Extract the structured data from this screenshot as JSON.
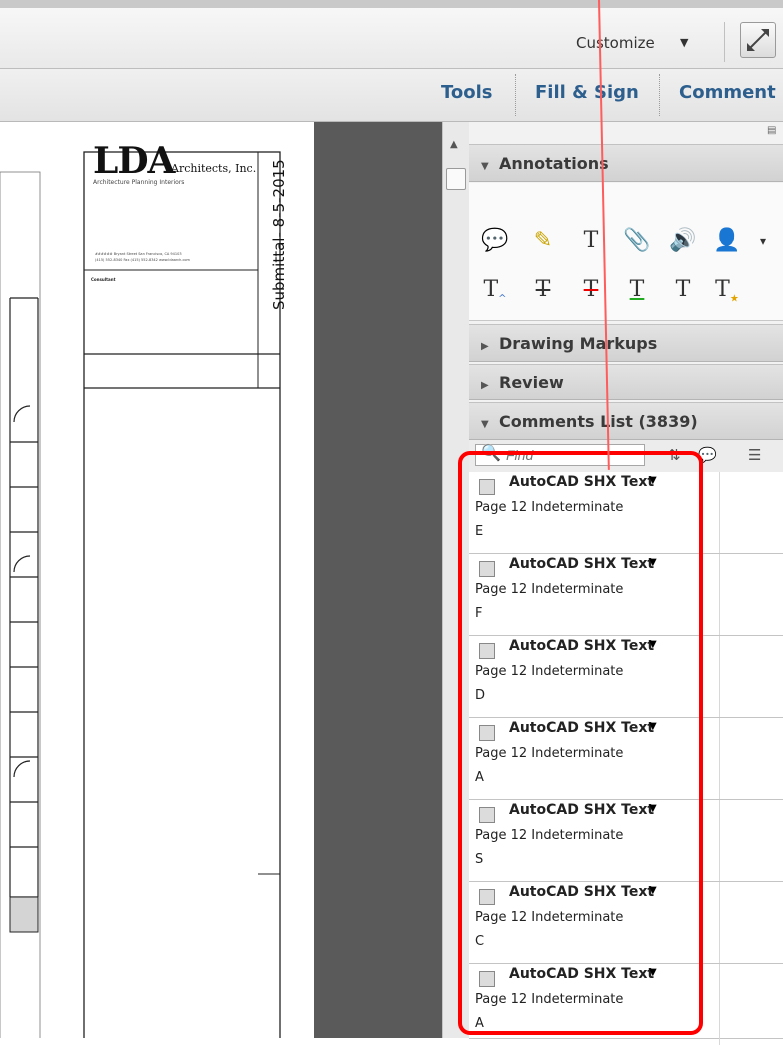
{
  "toolbar": {
    "customize_label": "Customize",
    "customize_caret": "▼",
    "tabs": [
      "Tools",
      "Fill & Sign",
      "Comment"
    ]
  },
  "document": {
    "firm_name": "LDA",
    "firm_suffix": "Architects, Inc.",
    "firm_tagline": "Architecture   Planning   Interiors",
    "address_line1": "###### Bryant Street   San Francisco, CA 94103",
    "address_line2": "(415) 552-8340   Fax (415) 552-8342   www.ldaarch.com",
    "consultant_label": "Consultant",
    "submittal": "Submittal- 8-5-2015"
  },
  "panel": {
    "sections": {
      "annotations": "Annotations",
      "drawing_markups": "Drawing Markups",
      "review": "Review",
      "comments_list": "Comments List (3839)"
    },
    "find_placeholder": "Find",
    "annotation_icons": [
      "sticky-note-icon",
      "highlight-text-icon",
      "add-text-icon",
      "attach-file-icon",
      "record-audio-icon",
      "stamp-icon",
      "insert-text-icon",
      "replace-text-icon",
      "strikethrough-icon",
      "underline-icon",
      "text-comment-icon",
      "text-correction-icon"
    ],
    "comments": [
      {
        "title": "AutoCAD SHX Text",
        "meta": "Page 12  Indeterminate",
        "body": "E"
      },
      {
        "title": "AutoCAD SHX Text",
        "meta": "Page 12  Indeterminate",
        "body": "F"
      },
      {
        "title": "AutoCAD SHX Text",
        "meta": "Page 12  Indeterminate",
        "body": "D"
      },
      {
        "title": "AutoCAD SHX Text",
        "meta": "Page 12  Indeterminate",
        "body": "A"
      },
      {
        "title": "AutoCAD SHX Text",
        "meta": "Page 12  Indeterminate",
        "body": "S"
      },
      {
        "title": "AutoCAD SHX Text",
        "meta": "Page 12  Indeterminate",
        "body": "C"
      },
      {
        "title": "AutoCAD SHX Text",
        "meta": "Page 12  Indeterminate",
        "body": "A"
      }
    ]
  },
  "colors": {
    "highlight": "#ff0000",
    "tab_text": "#2d5f8e"
  }
}
